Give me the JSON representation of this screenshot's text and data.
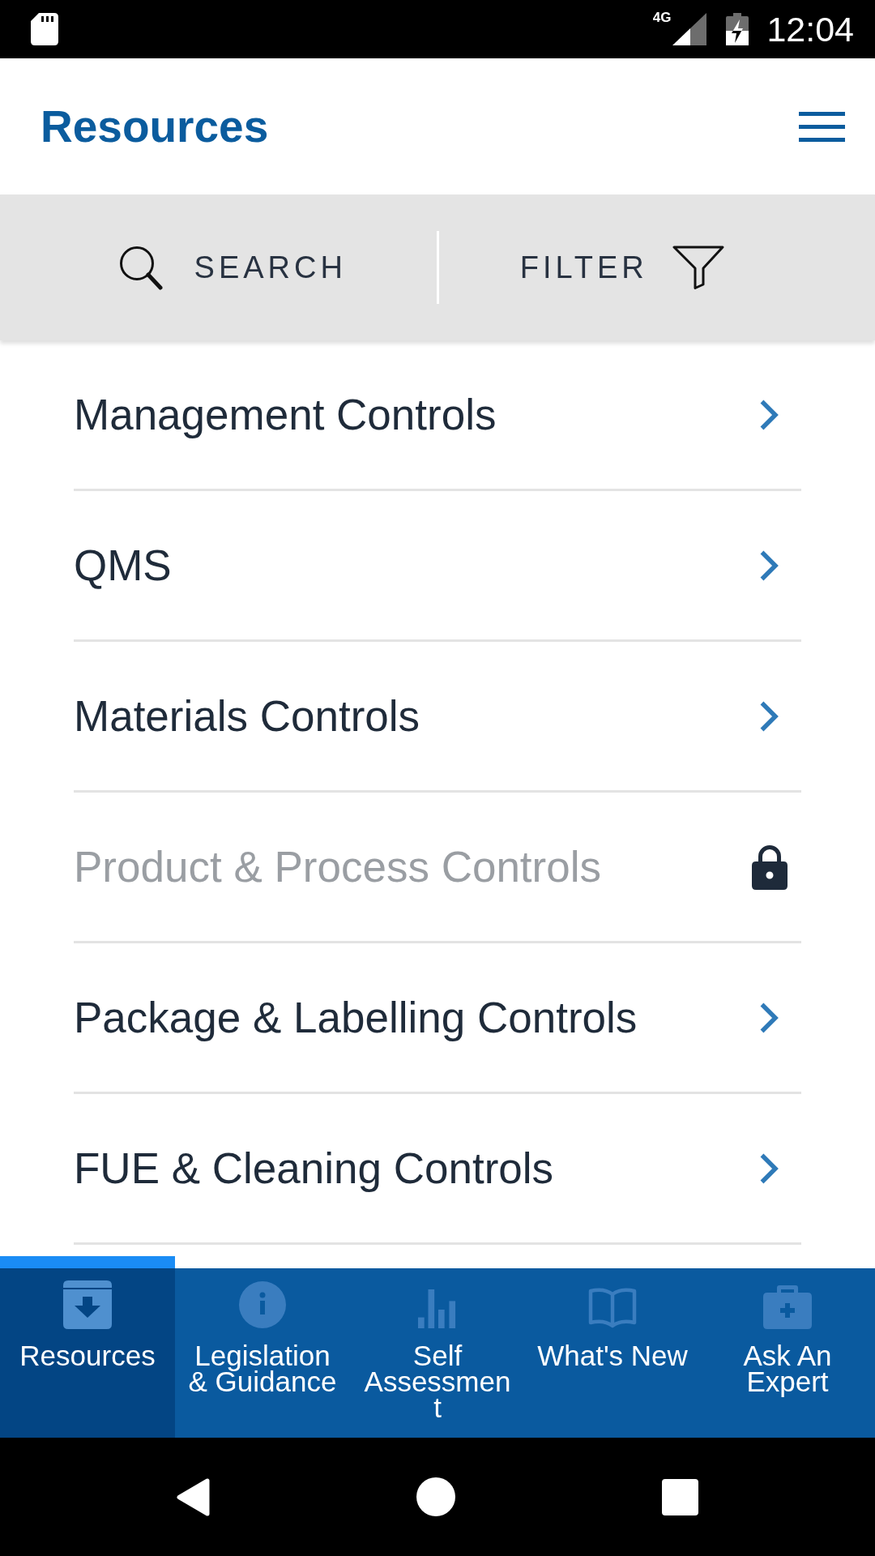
{
  "status_bar": {
    "network": "4G",
    "time": "12:04"
  },
  "header": {
    "title": "Resources"
  },
  "toolbar": {
    "search": "SEARCH",
    "filter": "FILTER"
  },
  "items": [
    {
      "label": "Management Controls",
      "locked": false
    },
    {
      "label": "QMS",
      "locked": false
    },
    {
      "label": "Materials Controls",
      "locked": false
    },
    {
      "label": "Product & Process Controls",
      "locked": true
    },
    {
      "label": "Package & Labelling Controls",
      "locked": false
    },
    {
      "label": "FUE & Cleaning Controls",
      "locked": false
    }
  ],
  "tabs": [
    {
      "label": "Resources",
      "selected": true
    },
    {
      "label": "Legislation & Guidance",
      "selected": false
    },
    {
      "label": "Self Assessment",
      "selected": false
    },
    {
      "label": "What's New",
      "selected": false
    },
    {
      "label": "Ask An Expert",
      "selected": false
    }
  ]
}
